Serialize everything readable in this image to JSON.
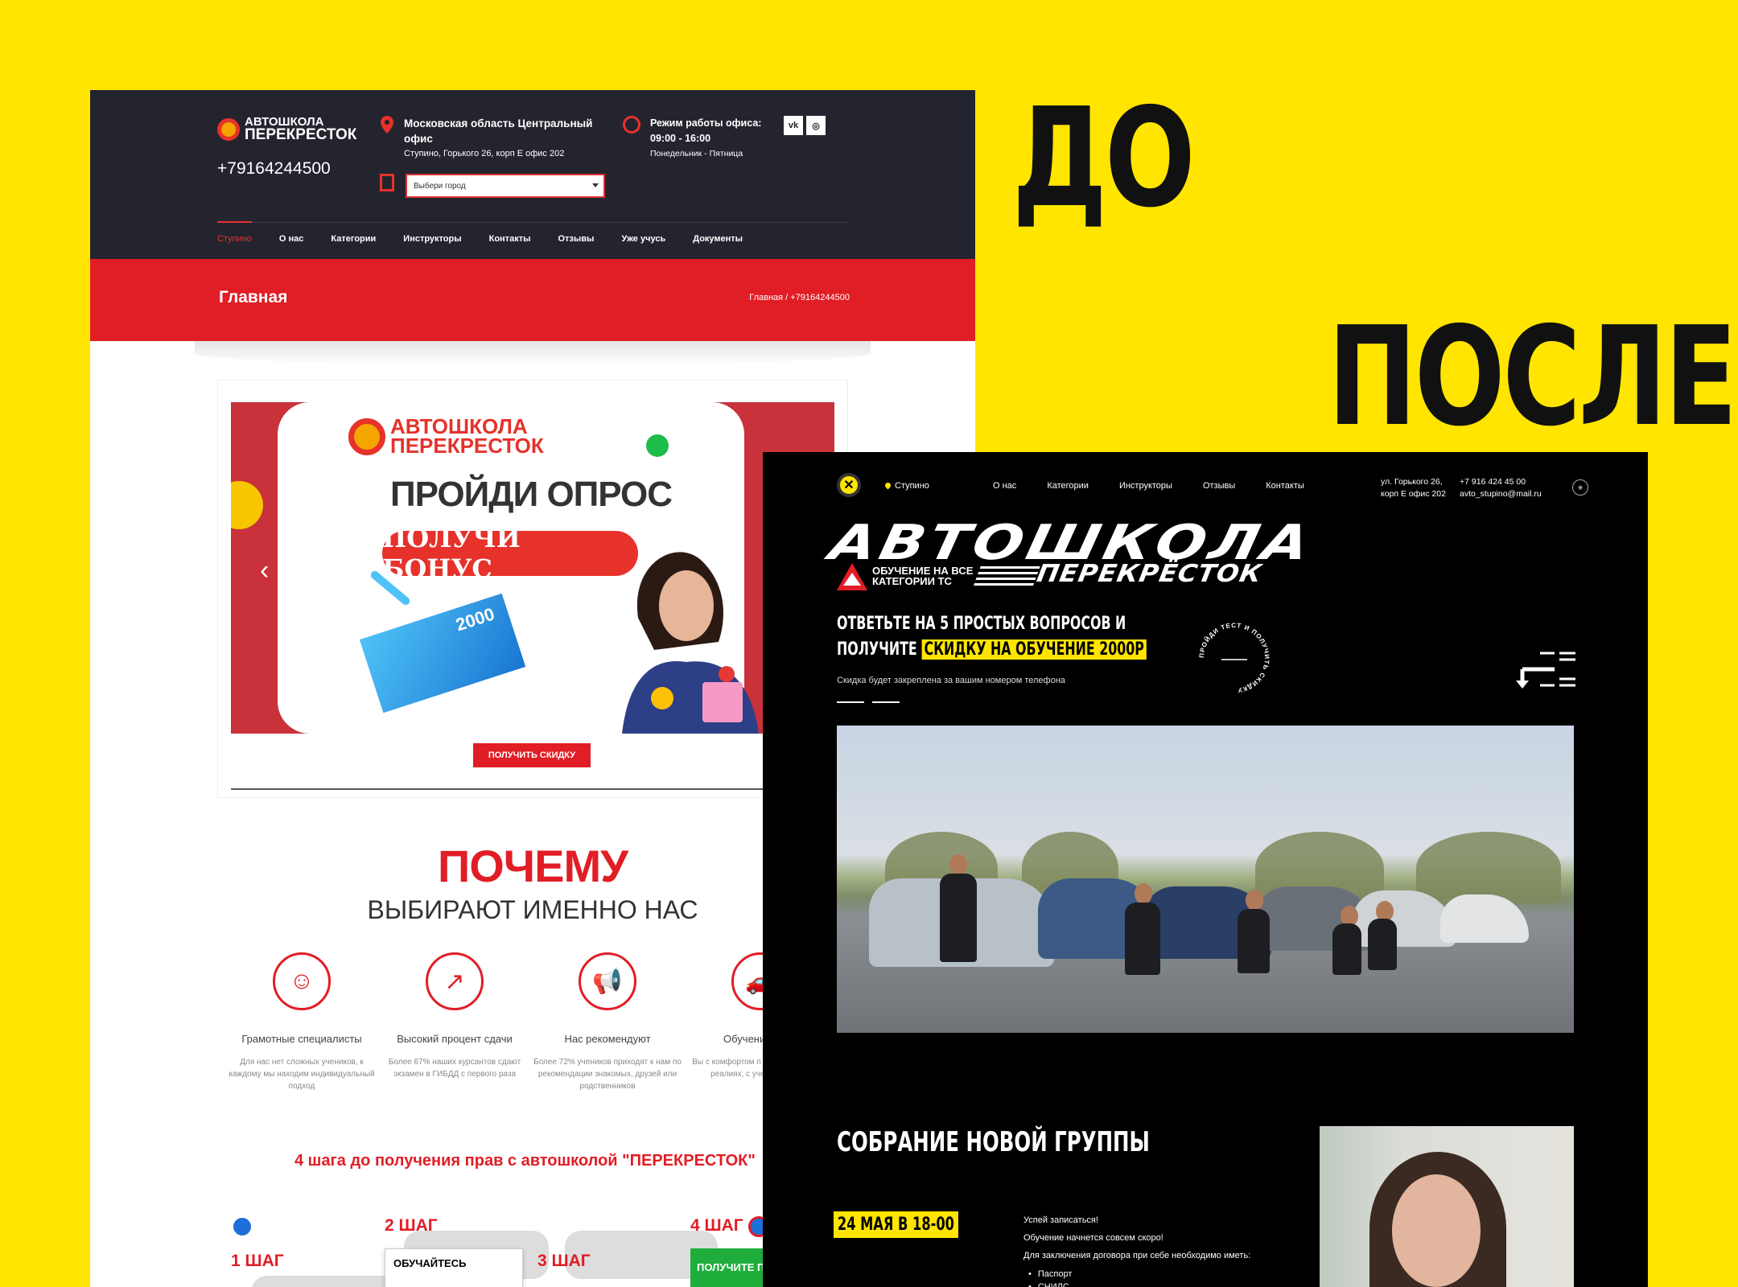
{
  "labels": {
    "before": "ДО",
    "after": "ПОСЛЕ"
  },
  "old_site": {
    "logo": {
      "line1": "АВТОШКОЛА",
      "line2": "ПЕРЕКРЕСТОК"
    },
    "phone": "+79164244500",
    "address": {
      "title": "Московская область Центральный офис",
      "detail": "Ступино, Горького 26, корп Е офис 202"
    },
    "hours": {
      "title": "Режим работы офиса:",
      "time": "09:00 - 16:00",
      "days": "Понедельник - Пятница"
    },
    "social": [
      "vk",
      "ig"
    ],
    "city_select_placeholder": "Выбери город",
    "nav": [
      "Ступино",
      "О нас",
      "Категории",
      "Инструкторы",
      "Контакты",
      "Отзывы",
      "Уже учусь",
      "Документы"
    ],
    "page_title": "Главная",
    "breadcrumb": "Главная / +79164244500",
    "banner": {
      "logo_line1": "АВТОШКОЛА",
      "logo_line2": "ПЕРЕКРЕСТОК",
      "heading": "ПРОЙДИ ОПРОС",
      "bonus": "ПОЛУЧИ БОНУС",
      "note": "2000"
    },
    "cta": "ПОЛУЧИТЬ СКИДКУ",
    "why": {
      "title": "ПОЧЕМУ",
      "subtitle": "ВЫБИРАЮТ ИМЕННО НАС"
    },
    "features": [
      {
        "title": "Грамотные специалисты",
        "desc": "Для нас нет сложных учеников, к каждому мы находим индивидуальный подход"
      },
      {
        "title": "Высокий процент сдачи",
        "desc": "Более 67% наших курсантов сдают экзамен в ГИБДД с первого раза"
      },
      {
        "title": "Нас рекомендуют",
        "desc": "Более 72% учеников приходят к нам по рекомендации знакомых, друзей или родственников"
      },
      {
        "title": "Обучение на М",
        "desc": "Вы с комфортом п вождения автомо реалиях, с учетом коробки"
      }
    ],
    "steps_title": "4 шага до получения прав с автошколой \"ПЕРЕКРЕСТОК\"",
    "steps": [
      "1 ШАГ",
      "2 ШАГ",
      "3 ШАГ",
      "4 ШАГ"
    ],
    "step_card": "ОБУЧАЙТЕСЬ",
    "step_green": "ПОЛУЧИТЕ П"
  },
  "new_site": {
    "city": "Ступино",
    "nav": [
      "О нас",
      "Категории",
      "Инструкторы",
      "Отзывы",
      "Контакты"
    ],
    "address": [
      "ул. Горького 26,",
      "корп Е офис 202"
    ],
    "contacts": [
      "+7 916 424 45 00",
      "avto_stupino@mail.ru"
    ],
    "title": "АВТОШКОЛА",
    "subtitle_small": [
      "ОБУЧЕНИЕ НА ВСЕ",
      "КАТЕГОРИИ ТС"
    ],
    "subtitle_big": "ПЕРЕКРЁСТОК",
    "offer_line1": "ОТВЕТЬТЕ НА 5 ПРОСТЫХ ВОПРОСОВ И",
    "offer_line2": "ПОЛУЧИТЕ",
    "offer_highlight": "СКИДКУ НА ОБУЧЕНИЕ 2000Р",
    "offer_note": "Скидка будет закреплена за вашим номером телефона",
    "badge": "ПРОЙДИ ТЕСТ И ПОЛУЧИТЬ СКИДКУ",
    "meeting_title": "СОБРАНИЕ НОВОЙ ГРУППЫ",
    "meeting_date": "24 МАЯ В 18-00",
    "meeting_info": [
      "Успей записаться!",
      "Обучение начнется совсем скоро!",
      "Для заключения договора при себе необходимо иметь:"
    ],
    "meeting_docs": [
      "Паспорт",
      "СНИЛС"
    ]
  }
}
